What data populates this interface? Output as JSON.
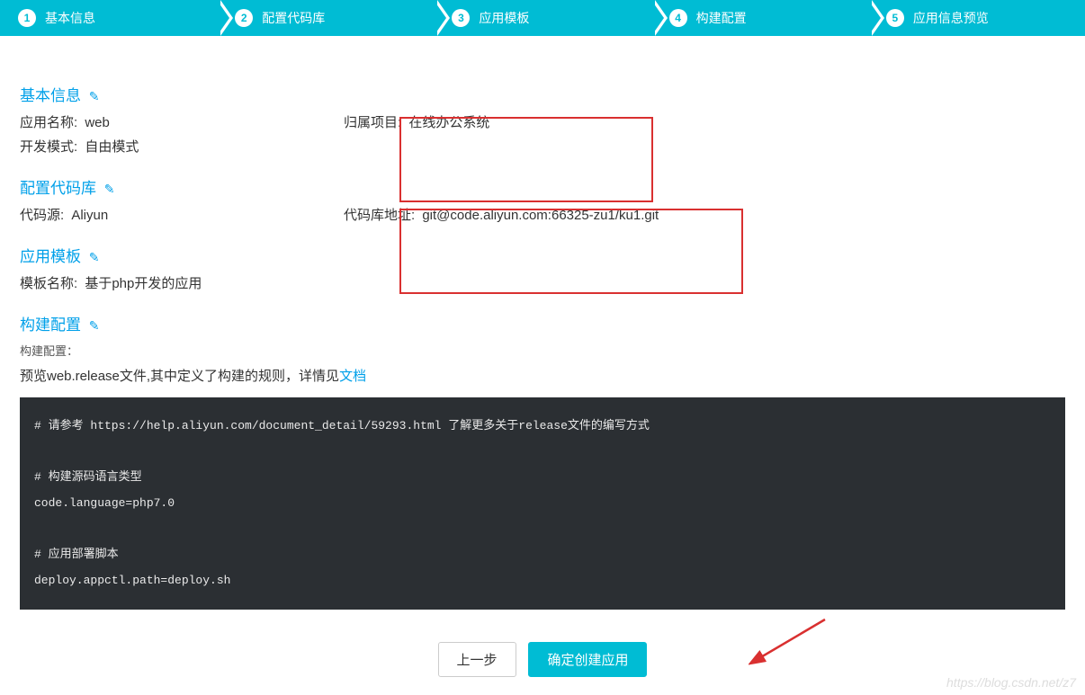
{
  "stepper": {
    "steps": [
      {
        "num": "1",
        "label": "基本信息"
      },
      {
        "num": "2",
        "label": "配置代码库"
      },
      {
        "num": "3",
        "label": "应用模板"
      },
      {
        "num": "4",
        "label": "构建配置"
      },
      {
        "num": "5",
        "label": "应用信息预览"
      }
    ]
  },
  "sections": {
    "basic": {
      "title": "基本信息",
      "app_name_label": "应用名称:",
      "app_name_value": "web",
      "project_label": "归属项目:",
      "project_value": "在线办公系统",
      "dev_mode_label": "开发模式:",
      "dev_mode_value": "自由模式"
    },
    "repo": {
      "title": "配置代码库",
      "source_label": "代码源:",
      "source_value": "Aliyun",
      "addr_label": "代码库地址:",
      "addr_value": "git@code.aliyun.com:66325-zu1/ku1.git"
    },
    "template": {
      "title": "应用模板",
      "tmpl_label": "模板名称:",
      "tmpl_value": "基于php开发的应用"
    },
    "build": {
      "title": "构建配置",
      "sub_label": "构建配置：",
      "preview_prefix": "预览web.release文件,其中定义了构建的规则，详情见",
      "doc_link": "文档",
      "code": "# 请参考 https://help.aliyun.com/document_detail/59293.html 了解更多关于release文件的编写方式\n\n# 构建源码语言类型\ncode.language=php7.0\n\n# 应用部署脚本\ndeploy.appctl.path=deploy.sh"
    }
  },
  "actions": {
    "prev": "上一步",
    "confirm": "确定创建应用"
  },
  "watermark": "https://blog.csdn.net/z7"
}
